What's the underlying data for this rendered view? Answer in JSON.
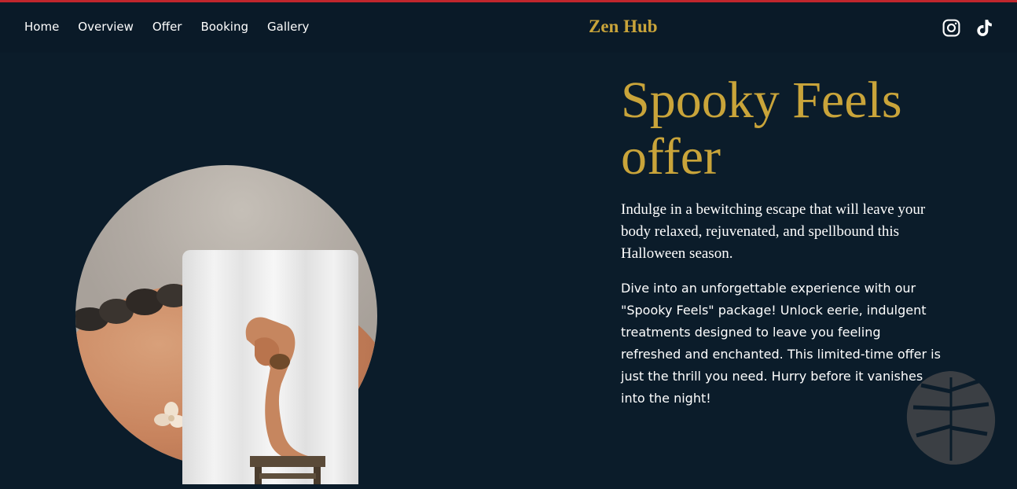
{
  "nav": {
    "links": [
      "Home",
      "Overview",
      "Offer",
      "Booking",
      "Gallery"
    ],
    "brand": "Zen Hub",
    "social": [
      "instagram-icon",
      "tiktok-icon"
    ]
  },
  "hero": {
    "title": "Spooky Feels offer",
    "intro": "Indulge in a bewitching escape that will leave your body relaxed, rejuvenated, and spellbound this Halloween season.",
    "body": "Dive into an unforgettable experience with our \"Spooky Feels\" package! Unlock eerie, indulgent treatments designed to leave you feeling refreshed and enchanted. This limited-time offer is just the thrill you need. Hurry before it vanishes into the night!"
  },
  "colors": {
    "background": "#0b1c2a",
    "navbar": "#0a1a28",
    "accent": "#c9a43a",
    "top_stripe": "#c0262d",
    "text": "#ffffff",
    "leaf": "#3b3f44"
  }
}
